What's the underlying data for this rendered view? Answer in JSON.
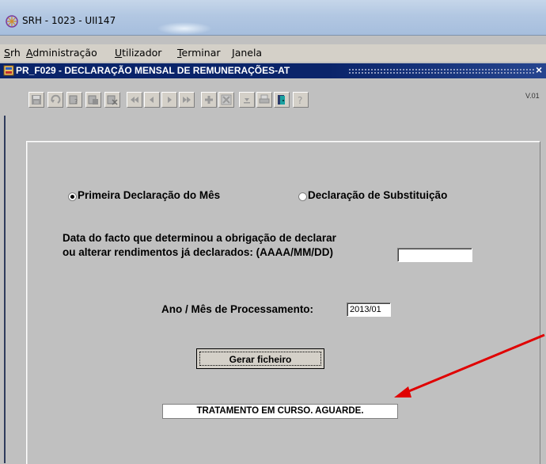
{
  "window": {
    "title": "SRH  - 1023 - UII147"
  },
  "menu": {
    "items": [
      {
        "first": "S",
        "rest": "rh"
      },
      {
        "first": "A",
        "rest": "dministração"
      },
      {
        "first": "U",
        "rest": "tilizador"
      },
      {
        "first": "T",
        "rest": "erminar"
      },
      {
        "first": "J",
        "rest": "anela"
      }
    ]
  },
  "form": {
    "title": "PR_F029 - DECLARAÇÃO MENSAL DE REMUNERAÇÕES-AT",
    "close": "×",
    "version": "V.01"
  },
  "toolbar": {
    "icons": [
      "save-icon",
      "undo-icon",
      "query-icon",
      "execute-query-icon",
      "cancel-query-icon",
      "first-record-icon",
      "previous-record-icon",
      "next-record-icon",
      "last-record-icon",
      "insert-record-icon",
      "delete-record-icon",
      "list-values-icon",
      "print-icon",
      "exit-icon",
      "help-icon"
    ]
  },
  "declaration": {
    "option_first": "Primeira Declaração do Mês",
    "option_substitution": "Declaração de Substituição",
    "selected": "first",
    "date_label_line1": "Data do facto que determinou a obrigação de declarar",
    "date_label_line2": "ou alterar rendimentos já declarados: (AAAA/MM/DD)",
    "date_value": "",
    "period_label": "Ano / Mês de Processamento:",
    "period_value": "2013/01",
    "generate_button": "Gerar ficheiro",
    "status_message": "TRATAMENTO EM CURSO. AGUARDE."
  },
  "colors": {
    "form_title_bg": "#0a246a",
    "arrow": "#e00000",
    "background": "#c0c0c0"
  }
}
